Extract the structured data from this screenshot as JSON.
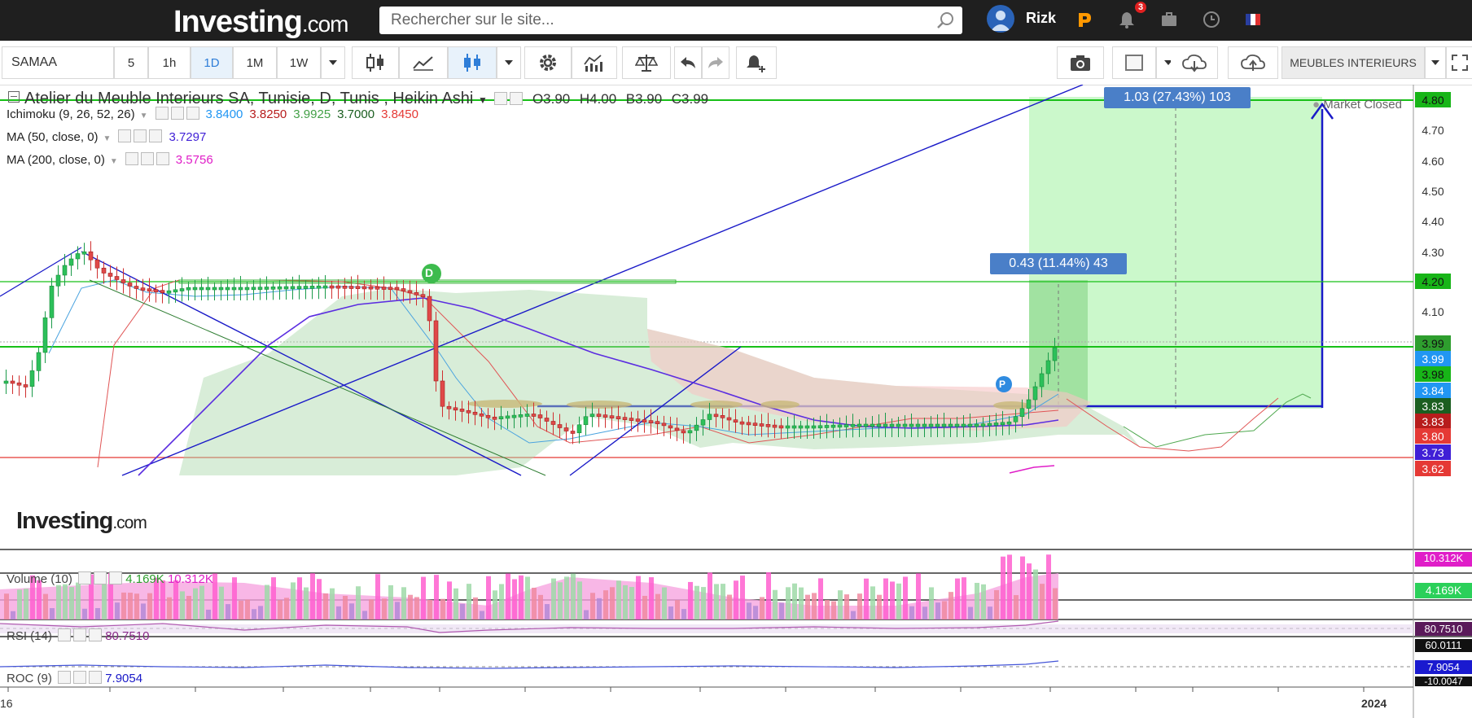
{
  "header": {
    "logo_main": "Investing",
    "logo_suffix": ".com",
    "search_placeholder": "Rechercher sur le site...",
    "user_name": "Rizk",
    "notification_count": "3"
  },
  "toolbar": {
    "symbol": "SAMAA",
    "intervals": [
      "5",
      "1h",
      "1D",
      "1M",
      "1W"
    ],
    "active_interval": "1D",
    "group_label": "MEUBLES INTERIEURS"
  },
  "chart": {
    "title": "Atelier du Meuble Interieurs SA, Tunisie, D, Tunis , Heikin Ashi",
    "ohlc": {
      "o": "O3.90",
      "h": "H4.00",
      "b": "B3.90",
      "c": "C3.99"
    },
    "market_status": "Market Closed",
    "watermark_main": "Investing",
    "watermark_suffix": ".com",
    "indicators": [
      {
        "label": "Ichimoku (9, 26, 52, 26)",
        "values": [
          {
            "text": "3.8400",
            "color": "#2196f3"
          },
          {
            "text": "3.8250",
            "color": "#b71c1c"
          },
          {
            "text": "3.9925",
            "color": "#43a047"
          },
          {
            "text": "3.7000",
            "color": "#1b5e20"
          },
          {
            "text": "3.8450",
            "color": "#e53935"
          }
        ]
      },
      {
        "label": "MA (50, close, 0)",
        "values": [
          {
            "text": "3.7297",
            "color": "#3f1fd6"
          }
        ]
      },
      {
        "label": "MA (200, close, 0)",
        "values": [
          {
            "text": "3.5756",
            "color": "#e01ec8"
          }
        ]
      }
    ],
    "price_axis": [
      "4.80",
      "4.70",
      "4.60",
      "4.50",
      "4.40",
      "4.30",
      "4.20",
      "4.10",
      "3.99",
      "3.99",
      "3.98",
      "3.84",
      "3.83",
      "3.83",
      "3.80",
      "3.73",
      "3.62"
    ],
    "price_tag_colors": [
      "#18b518",
      "#ffffff",
      "#ffffff",
      "#ffffff",
      "#ffffff",
      "#ffffff",
      "#18b518",
      "#ffffff",
      "#2e9e2e",
      "#2196f3",
      "#18b518",
      "#2196f3",
      "#1b5e20",
      "#b71c1c",
      "#e53935",
      "#3f1fd6",
      "#e53935"
    ],
    "measure_large": "1.03 (27.43%) 103",
    "measure_small": "0.43 (11.44%) 43",
    "marker_d": "D",
    "marker_p": "P",
    "x_axis": {
      "left": "16",
      "right": "2024"
    }
  },
  "volume": {
    "label": "Volume (10)",
    "v1": "4.169K",
    "v2": "10.312K",
    "axis_top": "10.312K",
    "axis_mid": "4.169K"
  },
  "rsi": {
    "label": "RSI (14)",
    "value": "80.7510",
    "axis_a": "80.7510",
    "axis_b": "60.0111"
  },
  "roc": {
    "label": "ROC (9)",
    "value": "7.9054",
    "axis_a": "7.9054",
    "axis_b": "-10.0047"
  }
}
